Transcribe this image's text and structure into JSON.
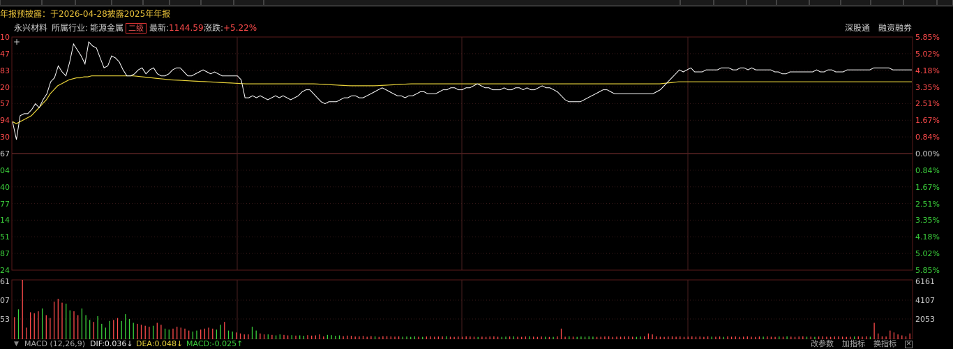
{
  "infobar": {
    "notice": "年报预披露：于2026-04-28披露2025年年报"
  },
  "header": {
    "stock_name": "永兴材料",
    "industry_label": "所属行业:",
    "industry_value": "能源金属",
    "industry_level": "二级",
    "latest_label": "最新:",
    "latest_value": "1144.59",
    "change_label": "涨跌:",
    "change_value": "+5.22%",
    "link_sz": "深股通",
    "link_margin": "融资融券"
  },
  "price_axis": {
    "left_up": [
      "10",
      "47",
      "83",
      "20",
      "57",
      "94",
      "30"
    ],
    "left_zero": "67",
    "left_down": [
      "04",
      "40",
      "77",
      "14",
      "51",
      "87",
      "24"
    ],
    "right_up": [
      "5.85%",
      "5.02%",
      "4.18%",
      "3.35%",
      "2.51%",
      "1.67%",
      "0.84%"
    ],
    "right_zero": "0.00%",
    "right_down": [
      "0.84%",
      "1.67%",
      "2.51%",
      "3.35%",
      "4.18%",
      "5.02%",
      "5.85%"
    ]
  },
  "volume_axis": {
    "left": [
      "61",
      "07",
      "53"
    ],
    "right": [
      "6161",
      "4107",
      "2053"
    ]
  },
  "macd_bar": {
    "label": "MACD (12,26,9)",
    "dif": "DIF:0.036↓",
    "dea": "DEA:0.048↓",
    "macd": "MACD:-0.025↑",
    "btn_params": "改参数",
    "btn_add": "加指标",
    "btn_switch": "换指标"
  },
  "colors": {
    "up": "#ff4b4b",
    "down": "#3cd23c",
    "price": "#ffffff",
    "avg": "#e8d23a",
    "grid": "#3a1a1a"
  },
  "chart_data": {
    "type": "line",
    "price_pct": [
      1.6,
      0.7,
      1.9,
      2.0,
      2.0,
      2.2,
      2.5,
      2.3,
      2.7,
      3.0,
      3.6,
      3.8,
      4.4,
      4.1,
      3.9,
      4.6,
      5.5,
      5.2,
      4.9,
      4.5,
      5.6,
      5.4,
      5.3,
      4.8,
      4.3,
      4.4,
      4.9,
      4.8,
      4.6,
      4.2,
      3.9,
      3.9,
      4.0,
      4.2,
      4.3,
      4.0,
      4.2,
      4.3,
      4.0,
      3.9,
      3.9,
      4.0,
      4.2,
      4.3,
      4.3,
      4.1,
      3.9,
      3.9,
      4.0,
      4.1,
      4.2,
      4.1,
      4.0,
      4.1,
      4.0,
      3.9,
      3.9,
      3.9,
      3.9,
      3.9,
      3.7,
      2.8,
      2.8,
      2.9,
      2.8,
      2.9,
      2.8,
      2.7,
      2.8,
      2.9,
      2.8,
      2.9,
      2.8,
      2.7,
      2.8,
      2.9,
      3.1,
      3.2,
      3.2,
      3.0,
      2.8,
      2.6,
      2.5,
      2.6,
      2.6,
      2.6,
      2.7,
      2.8,
      2.8,
      2.9,
      2.9,
      2.8,
      2.8,
      2.9,
      3.0,
      3.1,
      3.2,
      3.3,
      3.2,
      3.1,
      3.0,
      2.9,
      2.9,
      2.8,
      2.9,
      2.9,
      3.0,
      3.1,
      3.1,
      3.0,
      3.0,
      3.0,
      3.1,
      3.2,
      3.2,
      3.3,
      3.3,
      3.2,
      3.2,
      3.3,
      3.3,
      3.4,
      3.5,
      3.4,
      3.3,
      3.3,
      3.2,
      3.2,
      3.2,
      3.3,
      3.2,
      3.2,
      3.3,
      3.3,
      3.2,
      3.3,
      3.2,
      3.2,
      3.3,
      3.4,
      3.3,
      3.3,
      3.2,
      3.1,
      2.9,
      2.7,
      2.6,
      2.6,
      2.6,
      2.6,
      2.7,
      2.8,
      2.9,
      3.0,
      3.1,
      3.2,
      3.2,
      3.1,
      3.0,
      3.0,
      3.0,
      3.0,
      3.0,
      3.0,
      3.0,
      3.0,
      3.0,
      3.0,
      3.0,
      3.1,
      3.2,
      3.4,
      3.6,
      3.8,
      4.0,
      4.2,
      4.1,
      4.2,
      4.3,
      4.1,
      4.1,
      4.1,
      4.2,
      4.2,
      4.2,
      4.2,
      4.3,
      4.3,
      4.3,
      4.2,
      4.2,
      4.3,
      4.3,
      4.2,
      4.3,
      4.2,
      4.2,
      4.2,
      4.2,
      4.2,
      4.1,
      4.1,
      4.0,
      4.0,
      4.1,
      4.1,
      4.1,
      4.1,
      4.1,
      4.1,
      4.1,
      4.2,
      4.1,
      4.1,
      4.2,
      4.2,
      4.1,
      4.1,
      4.1,
      4.2,
      4.2,
      4.2,
      4.2,
      4.2,
      4.2,
      4.2,
      4.3,
      4.3,
      4.3,
      4.3,
      4.3,
      4.2,
      4.2,
      4.2,
      4.2,
      4.2,
      4.2
    ],
    "avg_pct": [
      1.6,
      1.5,
      1.6,
      1.7,
      1.8,
      1.9,
      2.1,
      2.3,
      2.5,
      2.7,
      3.0,
      3.2,
      3.4,
      3.5,
      3.6,
      3.7,
      3.75,
      3.8,
      3.8,
      3.85,
      3.85,
      3.9,
      3.9,
      3.9,
      3.9,
      3.9,
      3.9,
      3.9,
      3.9,
      3.9,
      3.9,
      3.9,
      3.9,
      3.88,
      3.86,
      3.84,
      3.82,
      3.8,
      3.78,
      3.76,
      3.74,
      3.72,
      3.7,
      3.69,
      3.68,
      3.67,
      3.66,
      3.65,
      3.64,
      3.63,
      3.62,
      3.61,
      3.6,
      3.59,
      3.58,
      3.57,
      3.56,
      3.55,
      3.54,
      3.53,
      3.52,
      3.51,
      3.5,
      3.5,
      3.5,
      3.5,
      3.5,
      3.5,
      3.5,
      3.5,
      3.5,
      3.5,
      3.5,
      3.5,
      3.5,
      3.5,
      3.5,
      3.5,
      3.5,
      3.5,
      3.5,
      3.49,
      3.48,
      3.47,
      3.46,
      3.45,
      3.44,
      3.43,
      3.42,
      3.41,
      3.4,
      3.4,
      3.4,
      3.4,
      3.4,
      3.4,
      3.4,
      3.41,
      3.42,
      3.43,
      3.44,
      3.45,
      3.46,
      3.47,
      3.48,
      3.49,
      3.5,
      3.5,
      3.5,
      3.5,
      3.5,
      3.5,
      3.5,
      3.5,
      3.5,
      3.5,
      3.5,
      3.5,
      3.5,
      3.5,
      3.5,
      3.5,
      3.5,
      3.5,
      3.5,
      3.5,
      3.5,
      3.5,
      3.5,
      3.5,
      3.5,
      3.5,
      3.5,
      3.5,
      3.5,
      3.5,
      3.5,
      3.5,
      3.5,
      3.5,
      3.5,
      3.5,
      3.5,
      3.5,
      3.5,
      3.5,
      3.5,
      3.5,
      3.5,
      3.5,
      3.5,
      3.5,
      3.5,
      3.5,
      3.5,
      3.5,
      3.5,
      3.5,
      3.5,
      3.5,
      3.5,
      3.5,
      3.5,
      3.5,
      3.5,
      3.5,
      3.5,
      3.5,
      3.5,
      3.5,
      3.5,
      3.5,
      3.5,
      3.52,
      3.54,
      3.56,
      3.58,
      3.6,
      3.6,
      3.6,
      3.6,
      3.6,
      3.6,
      3.6,
      3.6,
      3.6,
      3.6,
      3.6,
      3.6,
      3.6,
      3.6,
      3.6,
      3.6,
      3.6,
      3.6,
      3.6,
      3.6,
      3.6,
      3.6,
      3.6,
      3.6,
      3.6,
      3.6,
      3.6,
      3.6,
      3.6,
      3.6,
      3.6,
      3.6,
      3.6,
      3.6,
      3.6,
      3.6,
      3.6,
      3.6,
      3.6,
      3.6,
      3.6,
      3.6,
      3.6,
      3.6,
      3.6,
      3.6,
      3.6,
      3.6,
      3.6,
      3.6,
      3.6,
      3.6,
      3.6,
      3.6,
      3.6,
      3.6,
      3.6,
      3.6,
      3.6,
      3.6,
      3.6,
      3.6,
      3.6
    ],
    "ylim_pct": [
      -5.85,
      5.85
    ],
    "volume": [
      2300,
      3100,
      6161,
      1200,
      2800,
      2700,
      2900,
      3200,
      2500,
      2200,
      3900,
      4200,
      3800,
      3700,
      3000,
      2900,
      2500,
      3200,
      2500,
      2000,
      1800,
      2400,
      1600,
      1200,
      1900,
      2000,
      2200,
      1900,
      2600,
      2100,
      1700,
      1600,
      1500,
      1400,
      1300,
      1400,
      1700,
      1500,
      1100,
      1000,
      1100,
      1300,
      1200,
      1100,
      900,
      800,
      900,
      1000,
      1100,
      1200,
      1100,
      1000,
      1500,
      1800,
      900,
      800,
      700,
      600,
      500,
      500,
      1300,
      900,
      600,
      500,
      500,
      450,
      400,
      500,
      450,
      400,
      420,
      380,
      400,
      360,
      420,
      380,
      400,
      500,
      300,
      450,
      420,
      360,
      400,
      320,
      380,
      360,
      280,
      300,
      350,
      260,
      320,
      300,
      250,
      310,
      320,
      290,
      270,
      300,
      260,
      280,
      250,
      300,
      260,
      250,
      280,
      300,
      260,
      280,
      290,
      310,
      260,
      250,
      280,
      260,
      300,
      280,
      260,
      240,
      270,
      250,
      280,
      300,
      260,
      250,
      270,
      280,
      300,
      260,
      250,
      280,
      300,
      270,
      250,
      280,
      260,
      240,
      250,
      300,
      1100,
      260,
      300,
      270,
      250,
      280,
      260,
      300,
      270,
      250,
      260,
      280,
      300,
      250,
      270,
      260,
      280,
      300,
      260,
      250,
      280,
      300,
      600,
      500,
      300,
      260,
      250,
      280,
      300,
      260,
      290,
      250,
      270,
      300,
      260,
      280,
      250,
      300,
      270,
      260,
      280,
      250,
      300,
      260,
      280,
      250,
      270,
      300,
      260,
      250,
      280,
      270,
      300,
      260,
      250,
      280,
      260,
      300,
      270,
      250,
      280,
      300,
      260,
      270,
      250,
      280,
      300,
      260,
      250,
      280,
      300,
      270,
      250,
      260,
      280,
      300,
      270,
      300,
      260,
      1700,
      600,
      300,
      280,
      900,
      700,
      500,
      400,
      300,
      600
    ]
  }
}
